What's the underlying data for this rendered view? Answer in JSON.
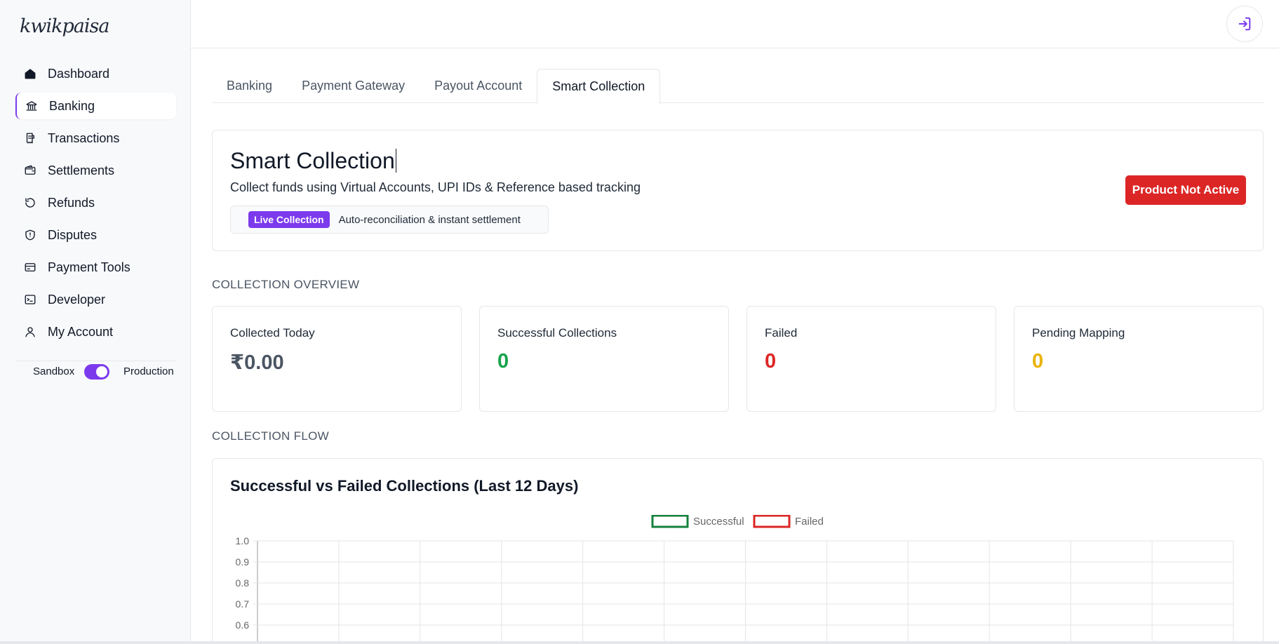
{
  "brand": {
    "logo_text": "kwikpaisa"
  },
  "sidebar": {
    "items": [
      {
        "label": "Dashboard",
        "icon": "home-icon"
      },
      {
        "label": "Banking",
        "icon": "bank-icon"
      },
      {
        "label": "Transactions",
        "icon": "receipt-icon"
      },
      {
        "label": "Settlements",
        "icon": "wallet-icon"
      },
      {
        "label": "Refunds",
        "icon": "refund-icon"
      },
      {
        "label": "Disputes",
        "icon": "shield-icon"
      },
      {
        "label": "Payment Tools",
        "icon": "card-icon"
      },
      {
        "label": "Developer",
        "icon": "terminal-icon"
      },
      {
        "label": "My Account",
        "icon": "user-icon"
      }
    ],
    "active_index": 1,
    "env_toggle": {
      "left_label": "Sandbox",
      "right_label": "Production",
      "value": "Production"
    }
  },
  "topbar": {
    "logout_icon": "logout-icon"
  },
  "tabs": [
    {
      "label": "Banking"
    },
    {
      "label": "Payment Gateway"
    },
    {
      "label": "Payout Account"
    },
    {
      "label": "Smart Collection"
    }
  ],
  "active_tab": 3,
  "hero": {
    "title": "Smart Collection",
    "subtitle": "Collect funds using Virtual Accounts, UPI IDs & Reference based tracking",
    "badge": "Live Collection",
    "badge_text": "Auto-reconciliation & instant settlement",
    "status_button": "Product Not Active"
  },
  "overview": {
    "heading": "COLLECTION OVERVIEW",
    "cards": [
      {
        "label": "Collected Today",
        "value": "₹0.00",
        "color": "#4b5563"
      },
      {
        "label": "Successful Collections",
        "value": "0",
        "color": "#16a34a"
      },
      {
        "label": "Failed",
        "value": "0",
        "color": "#dc2626"
      },
      {
        "label": "Pending Mapping",
        "value": "0",
        "color": "#eab308"
      }
    ]
  },
  "flow": {
    "heading": "COLLECTION FLOW",
    "chart_title": "Successful vs Failed Collections (Last 12 Days)"
  },
  "colors": {
    "accent": "#7c3aed",
    "success": "#16a34a",
    "danger": "#dc2626",
    "warning": "#eab308"
  },
  "chart_data": {
    "type": "line",
    "title": "Successful vs Failed Collections (Last 12 Days)",
    "legend_position": "top-center",
    "series": [
      {
        "name": "Successful",
        "color": "#15803d",
        "values": []
      },
      {
        "name": "Failed",
        "color": "#dc2626",
        "values": []
      }
    ],
    "y_ticks": [
      "1.0",
      "0.9",
      "0.8",
      "0.7",
      "0.6"
    ],
    "ylim": [
      0,
      1
    ],
    "x_count": 12,
    "grid": true
  }
}
